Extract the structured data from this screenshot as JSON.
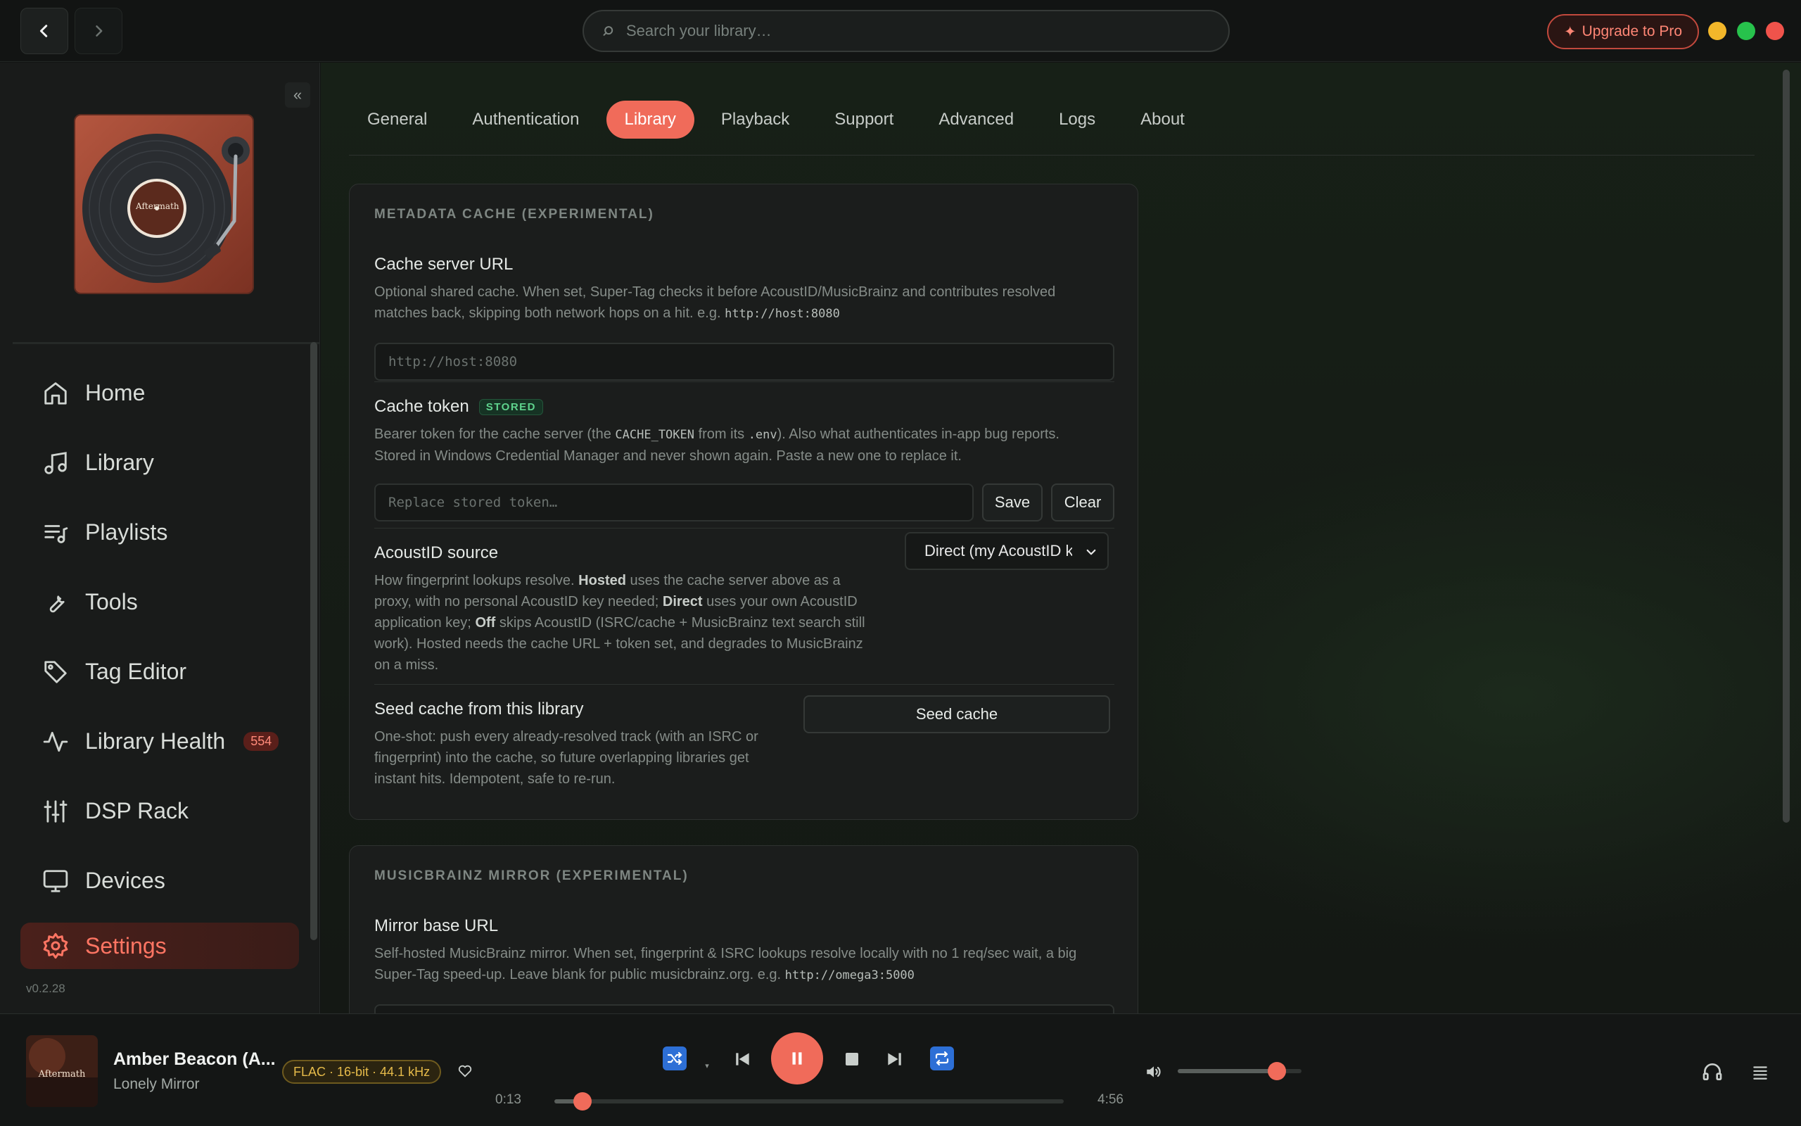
{
  "titlebar": {
    "search_placeholder": "Search your library…",
    "upgrade_label": "Upgrade to Pro",
    "window_colors": [
      "#f2b72a",
      "#27c24c",
      "#f0534b"
    ]
  },
  "sidebar": {
    "art_label": "Aftermath",
    "items": [
      {
        "label": "Home",
        "icon": "home-icon"
      },
      {
        "label": "Library",
        "icon": "music-note-icon"
      },
      {
        "label": "Playlists",
        "icon": "playlist-icon"
      },
      {
        "label": "Tools",
        "icon": "wrench-icon"
      },
      {
        "label": "Tag Editor",
        "icon": "tag-icon"
      },
      {
        "label": "Library Health",
        "icon": "pulse-icon",
        "badge": "554"
      },
      {
        "label": "DSP Rack",
        "icon": "sliders-icon"
      },
      {
        "label": "Devices",
        "icon": "monitor-icon"
      },
      {
        "label": "Settings",
        "icon": "gear-icon",
        "active": true
      }
    ],
    "version": "v0.2.28"
  },
  "tabs": [
    "General",
    "Authentication",
    "Library",
    "Playback",
    "Support",
    "Advanced",
    "Logs",
    "About"
  ],
  "active_tab": "Library",
  "metadata_cache": {
    "title": "METADATA CACHE (EXPERIMENTAL)",
    "cache_url": {
      "label": "Cache server URL",
      "desc_1": "Optional shared cache. When set, Super-Tag checks it before AcoustID/MusicBrainz and contributes resolved",
      "desc_2": "matches back, skipping both network hops on a hit. e.g.",
      "desc_code": "http://host:8080",
      "placeholder": "http://host:8080"
    },
    "cache_token": {
      "label": "Cache token",
      "badge": "STORED",
      "desc_a": "Bearer token for the cache server (the",
      "desc_code_1": "CACHE_TOKEN",
      "desc_b": "from its",
      "desc_code_2": ".env",
      "desc_c": "). Also what authenticates in-app bug reports.",
      "desc_2": "Stored in Windows Credential Manager and never shown again. Paste a new one to replace it.",
      "placeholder": "Replace stored token…",
      "save_label": "Save",
      "clear_label": "Clear"
    },
    "acoustid": {
      "label": "AcoustID source",
      "l1a": "How fingerprint lookups resolve.",
      "l1b": "Hosted",
      "l1c": "uses the cache server above as a",
      "l2a": "proxy, with no personal AcoustID key needed;",
      "l2b": "Direct",
      "l2c": "uses your own AcoustID",
      "l3a": "application key;",
      "l3b": "Off",
      "l3c": "skips AcoustID (ISRC/cache + MusicBrainz text search still",
      "l4": "work). Hosted needs the cache URL + token set, and degrades to MusicBrainz",
      "l5": "on a miss.",
      "selected": "Direct (my AcoustID key)"
    },
    "seed": {
      "label": "Seed cache from this library",
      "l1": "One-shot: push every already-resolved track (with an ISRC or",
      "l2": "fingerprint) into the cache, so future overlapping libraries get",
      "l3": "instant hits. Idempotent, safe to re-run.",
      "button": "Seed cache"
    }
  },
  "mirror": {
    "title": "MUSICBRAINZ MIRROR (EXPERIMENTAL)",
    "label": "Mirror base URL",
    "desc_1": "Self-hosted MusicBrainz mirror. When set, fingerprint & ISRC lookups resolve locally with no 1 req/sec wait, a big",
    "desc_2": "Super-Tag speed-up. Leave blank for public musicbrainz.org. e.g.",
    "desc_code": "http://omega3:5000",
    "placeholder": "http://omega3:5000"
  },
  "player": {
    "art_label": "Aftermath",
    "title": "Amber Beacon (A...",
    "artist": "Lonely Mirror",
    "format": "FLAC · 16-bit · 44.1 kHz",
    "elapsed": "0:13",
    "duration": "4:56",
    "progress": 0.055,
    "volume": 0.8,
    "accent": "#f06b5a"
  }
}
